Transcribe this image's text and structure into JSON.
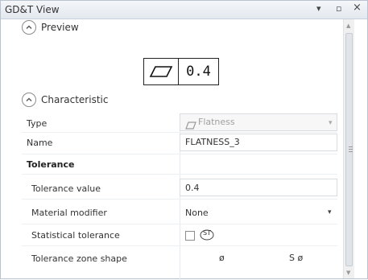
{
  "window": {
    "title": "GD&T View",
    "pin_glyph": "▾",
    "float_glyph": "▫",
    "close_glyph": "×"
  },
  "preview": {
    "header": "Preview",
    "frame": {
      "symbol": "flatness-icon",
      "value": "0.4"
    }
  },
  "characteristic": {
    "header": "Characteristic",
    "type_label": "Type",
    "type_value": "Flatness",
    "name_label": "Name",
    "name_value": "FLATNESS_3"
  },
  "tolerance": {
    "group_label": "Tolerance",
    "value_label": "Tolerance value",
    "value": "0.4",
    "material_label": "Material modifier",
    "material_value": "None",
    "statistical_label": "Statistical tolerance",
    "statistical_badge": "ST",
    "statistical_checked": false,
    "zone_label": "Tolerance zone shape",
    "zone_diameter": "ø",
    "zone_spherical": "S ø"
  },
  "icons": {
    "collapse": "collapse-chevron-up-icon",
    "dropdown": "chevron-down-icon"
  }
}
